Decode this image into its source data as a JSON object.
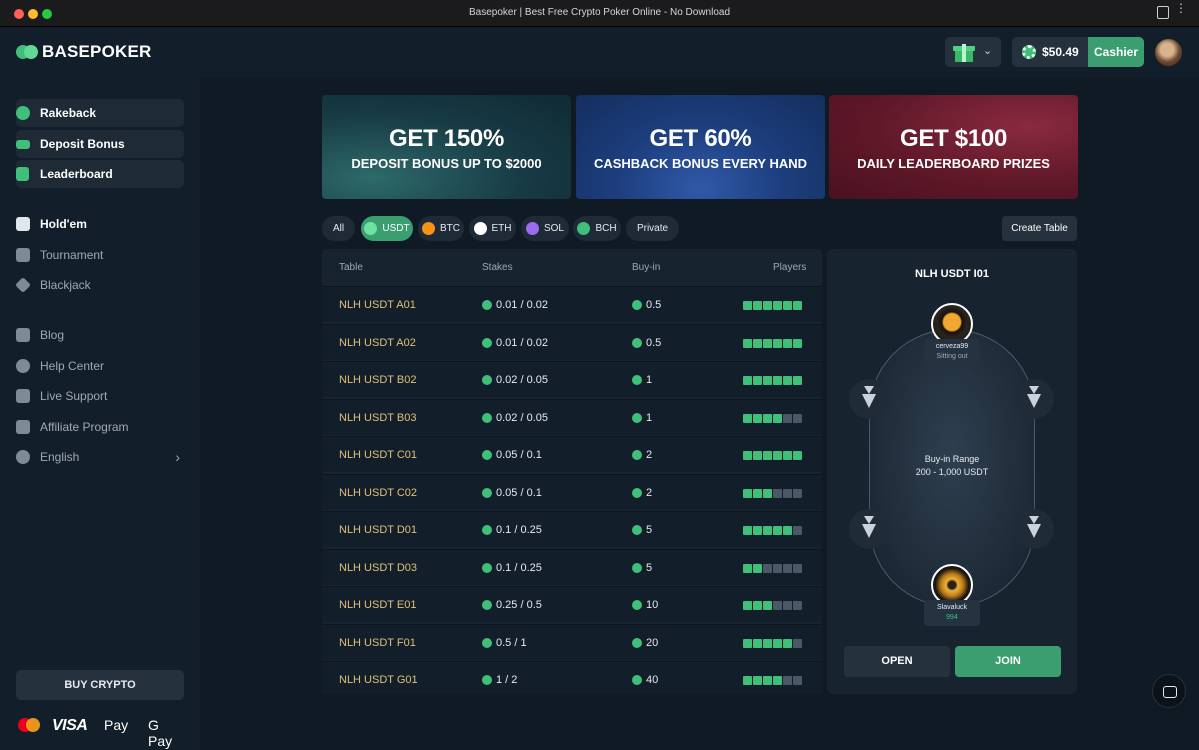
{
  "window": {
    "title": "Basepoker | Best Free Crypto Poker Online - No Download"
  },
  "header": {
    "logo_text": "BASEPOKER",
    "balance": "$50.49",
    "cashier_label": "Cashier"
  },
  "sidebar": {
    "items": [
      {
        "label": "Rakeback",
        "icon": "rakeback-icon"
      },
      {
        "label": "Deposit Bonus",
        "icon": "deposit-bonus-icon"
      },
      {
        "label": "Leaderboard",
        "icon": "leaderboard-icon"
      },
      {
        "label": "Hold'em",
        "icon": "cards-icon"
      },
      {
        "label": "Tournament",
        "icon": "trophy-icon"
      },
      {
        "label": "Blackjack",
        "icon": "blackjack-icon"
      },
      {
        "label": "Blog",
        "icon": "blog-icon"
      },
      {
        "label": "Help Center",
        "icon": "help-icon"
      },
      {
        "label": "Live Support",
        "icon": "support-icon"
      },
      {
        "label": "Affiliate Program",
        "icon": "affiliate-icon"
      },
      {
        "label": "English",
        "icon": "globe-icon"
      }
    ],
    "buy_crypto": "BUY CRYPTO",
    "payments": {
      "visa": "VISA",
      "apple_pay": "Pay",
      "google_pay": "G Pay"
    }
  },
  "banners": [
    {
      "headline": "GET 150%",
      "sub": "DEPOSIT BONUS UP TO $2000"
    },
    {
      "headline": "GET 60%",
      "sub": "CASHBACK BONUS EVERY HAND"
    },
    {
      "headline": "GET $100",
      "sub": "DAILY LEADERBOARD PRIZES"
    }
  ],
  "filters": [
    {
      "label": "All",
      "color": ""
    },
    {
      "label": "USDT",
      "color": "#3fbf7a"
    },
    {
      "label": "BTC",
      "color": "#f7931a"
    },
    {
      "label": "ETH",
      "color": "#ffffff"
    },
    {
      "label": "SOL",
      "color": "#9b6cf0"
    },
    {
      "label": "BCH",
      "color": "#3fbf7a"
    },
    {
      "label": "Private",
      "color": ""
    }
  ],
  "active_filter": "USDT",
  "create_table": "Create Table",
  "table_list": {
    "headers": {
      "table": "Table",
      "stakes": "Stakes",
      "buyin": "Buy-in",
      "players": "Players"
    },
    "rows": [
      {
        "name": "NLH USDT A01",
        "stakes": "0.01 / 0.02",
        "buyin": "0.5",
        "seated": 6,
        "seats": 6
      },
      {
        "name": "NLH USDT A02",
        "stakes": "0.01 / 0.02",
        "buyin": "0.5",
        "seated": 6,
        "seats": 6
      },
      {
        "name": "NLH USDT B02",
        "stakes": "0.02 / 0.05",
        "buyin": "1",
        "seated": 6,
        "seats": 6
      },
      {
        "name": "NLH USDT B03",
        "stakes": "0.02 / 0.05",
        "buyin": "1",
        "seated": 4,
        "seats": 6
      },
      {
        "name": "NLH USDT C01",
        "stakes": "0.05 / 0.1",
        "buyin": "2",
        "seated": 6,
        "seats": 6
      },
      {
        "name": "NLH USDT C02",
        "stakes": "0.05 / 0.1",
        "buyin": "2",
        "seated": 3,
        "seats": 6
      },
      {
        "name": "NLH USDT D01",
        "stakes": "0.1 / 0.25",
        "buyin": "5",
        "seated": 5,
        "seats": 6
      },
      {
        "name": "NLH USDT D03",
        "stakes": "0.1 / 0.25",
        "buyin": "5",
        "seated": 2,
        "seats": 6
      },
      {
        "name": "NLH USDT E01",
        "stakes": "0.25 / 0.5",
        "buyin": "10",
        "seated": 3,
        "seats": 6
      },
      {
        "name": "NLH USDT F01",
        "stakes": "0.5 / 1",
        "buyin": "20",
        "seated": 5,
        "seats": 6
      },
      {
        "name": "NLH USDT G01",
        "stakes": "1 / 2",
        "buyin": "40",
        "seated": 4,
        "seats": 6
      }
    ]
  },
  "preview": {
    "title": "NLH USDT I01",
    "range_label": "Buy-in Range",
    "range_value": "200 - 1,000 USDT",
    "player_top": {
      "name": "cerveza99",
      "status": "Sitting out"
    },
    "player_bottom": {
      "name": "Slavaluck",
      "stack": "994"
    },
    "open_label": "OPEN",
    "join_label": "JOIN"
  }
}
